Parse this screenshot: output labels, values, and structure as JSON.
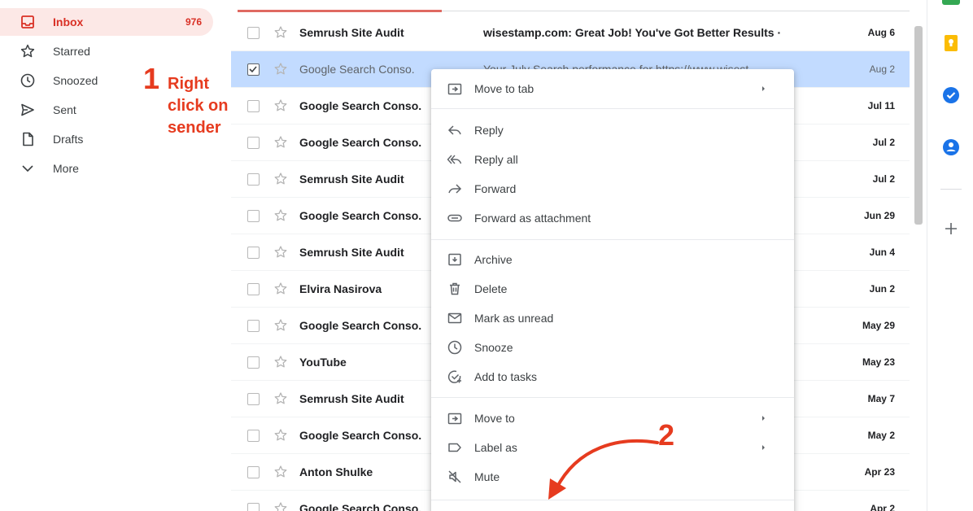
{
  "sidebar": {
    "items": [
      {
        "label": "Inbox",
        "count": "976",
        "icon": "inbox-icon"
      },
      {
        "label": "Starred",
        "icon": "star-icon"
      },
      {
        "label": "Snoozed",
        "icon": "clock-icon"
      },
      {
        "label": "Sent",
        "icon": "send-icon"
      },
      {
        "label": "Drafts",
        "icon": "draft-icon"
      },
      {
        "label": "More",
        "icon": "chevron-down-icon"
      }
    ]
  },
  "annotation1": {
    "number": "1",
    "text": "Right click on sender"
  },
  "annotation2": {
    "number": "2"
  },
  "emails": [
    {
      "sender": "Semrush Site Audit",
      "subject": "wisestamp.com: Great Job! You've Got Better Results ·",
      "date": "Aug 6",
      "selected": false
    },
    {
      "sender": "Google Search Conso.",
      "subject": "Your July Search performance for https://www.wisest...",
      "date": "Aug 2",
      "selected": true
    },
    {
      "sender": "Google Search Conso.",
      "subject": "",
      "date": "Jul 11",
      "selected": false
    },
    {
      "sender": "Google Search Conso.",
      "subject": "",
      "date": "Jul 2",
      "selected": false
    },
    {
      "sender": "Semrush Site Audit",
      "subject": "",
      "date": "Jul 2",
      "selected": false
    },
    {
      "sender": "Google Search Conso.",
      "subject": "",
      "date": "Jun 29",
      "selected": false
    },
    {
      "sender": "Semrush Site Audit",
      "subject": "",
      "date": "Jun 4",
      "selected": false
    },
    {
      "sender": "Elvira Nasirova",
      "subject": "",
      "date": "Jun 2",
      "selected": false
    },
    {
      "sender": "Google Search Conso.",
      "subject": "",
      "date": "May 29",
      "selected": false
    },
    {
      "sender": "YouTube",
      "subject": "",
      "date": "May 23",
      "selected": false
    },
    {
      "sender": "Semrush Site Audit",
      "subject": "",
      "date": "May 7",
      "selected": false
    },
    {
      "sender": "Google Search Conso.",
      "subject": "",
      "date": "May 2",
      "selected": false
    },
    {
      "sender": "Anton Shulke",
      "subject": "",
      "date": "Apr 23",
      "selected": false
    },
    {
      "sender": "Google Search Conso.",
      "subject": "",
      "date": "Apr 2",
      "selected": false
    }
  ],
  "context_menu": {
    "items": [
      {
        "label": "Move to tab",
        "icon": "move-to-tab-icon",
        "submenu": true
      },
      {
        "label": "Reply",
        "icon": "reply-icon"
      },
      {
        "label": "Reply all",
        "icon": "reply-all-icon"
      },
      {
        "label": "Forward",
        "icon": "forward-icon"
      },
      {
        "label": "Forward as attachment",
        "icon": "forward-attachment-icon"
      },
      {
        "label": "Archive",
        "icon": "archive-icon"
      },
      {
        "label": "Delete",
        "icon": "trash-icon"
      },
      {
        "label": "Mark as unread",
        "icon": "mail-icon"
      },
      {
        "label": "Snooze",
        "icon": "clock-icon"
      },
      {
        "label": "Add to tasks",
        "icon": "add-task-icon"
      },
      {
        "label": "Move to",
        "icon": "move-to-icon",
        "submenu": true
      },
      {
        "label": "Label as",
        "icon": "label-icon",
        "submenu": true
      },
      {
        "label": "Mute",
        "icon": "mute-icon"
      }
    ]
  },
  "rail": {
    "icons": [
      "keep-icon",
      "tasks-icon",
      "contacts-icon",
      "add-icon"
    ]
  },
  "colors": {
    "accent": "#d93025",
    "selected_row": "#c2dbff",
    "annotation": "#e63b1f"
  }
}
